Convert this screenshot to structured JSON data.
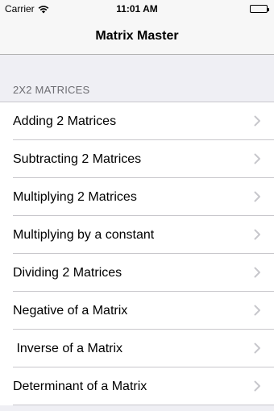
{
  "status_bar": {
    "carrier": "Carrier",
    "time": "11:01 AM",
    "wifi_icon": "wifi-icon",
    "battery_icon": "battery-icon"
  },
  "nav": {
    "title": "Matrix Master"
  },
  "section": {
    "title": "2X2 MATRICES"
  },
  "rows": [
    {
      "label": "Adding 2 Matrices"
    },
    {
      "label": "Subtracting 2 Matrices"
    },
    {
      "label": "Multiplying 2 Matrices"
    },
    {
      "label": "Multiplying by a constant"
    },
    {
      "label": "Dividing 2 Matrices"
    },
    {
      "label": "Negative of a Matrix"
    },
    {
      "label": " Inverse of a Matrix"
    },
    {
      "label": "Determinant of a Matrix"
    }
  ],
  "colors": {
    "background": "#efeff4",
    "bar": "#f7f7f7",
    "separator": "#c8c7cc",
    "section_text": "#6d6d72",
    "chevron": "#c7c7cc"
  }
}
